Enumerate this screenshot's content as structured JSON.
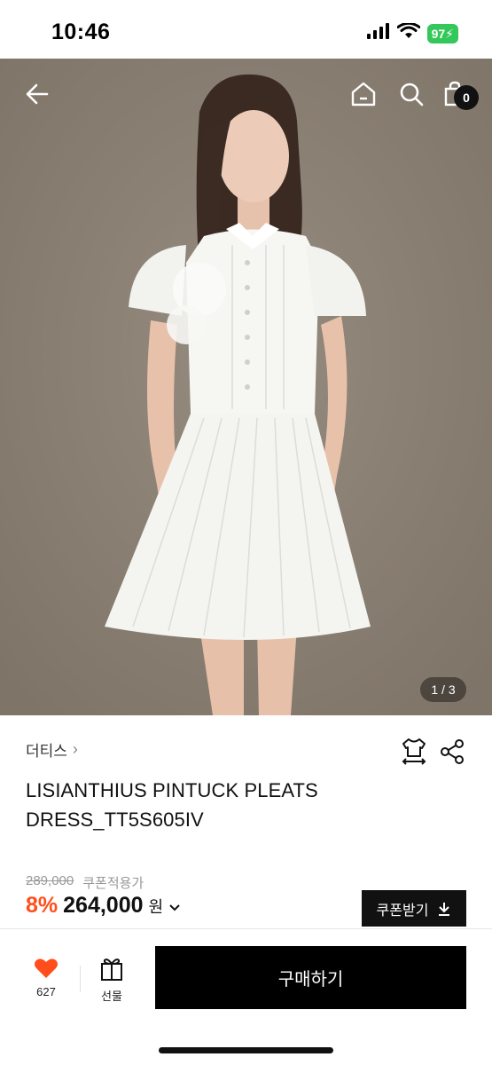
{
  "status_bar": {
    "time": "10:46",
    "battery": "97",
    "icons": [
      "signal-icon",
      "wifi-icon",
      "battery-icon"
    ]
  },
  "hero": {
    "page_indicator": "1 / 3",
    "cart_count": "0",
    "icons": [
      "back-arrow-icon",
      "home-icon",
      "search-icon",
      "shopping-bag-icon"
    ],
    "background_color": "#8a7f73"
  },
  "product": {
    "brand": "더티스",
    "title": "LISIANTHIUS PINTUCK PLEATS DRESS_TT5S605IV",
    "original_price": "289,000",
    "coupon_label": "쿠폰적용가",
    "discount": "8%",
    "price": "264,000",
    "currency": "원",
    "coupon_button": "쿠폰받기"
  },
  "bottom_bar": {
    "like_count": "627",
    "gift_label": "선물",
    "buy_label": "구매하기"
  },
  "colors": {
    "discount": "#ff4e1b",
    "like": "#ff4e1b",
    "primary_button": "#000000"
  }
}
